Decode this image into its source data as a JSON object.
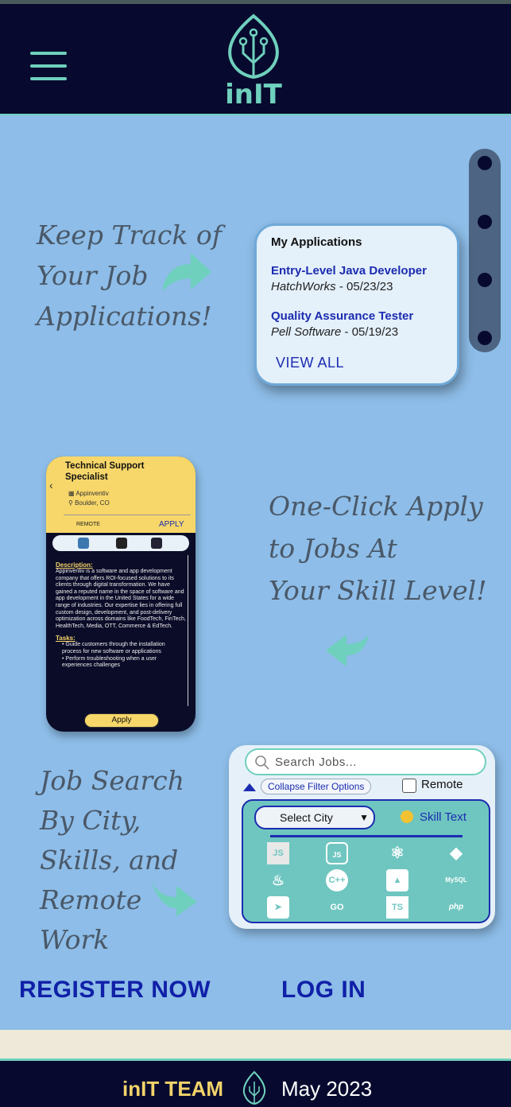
{
  "app": {
    "logo_text": "inIT"
  },
  "hero": {
    "track_lines": [
      "Keep Track of",
      "Your Job",
      "Applications!"
    ],
    "apply_lines": [
      "One-Click Apply",
      "to Jobs At",
      "Your Skill Level!"
    ],
    "search_lines": [
      "Job Search",
      "By City,",
      "Skills, and",
      "Remote",
      "Work"
    ]
  },
  "my_applications": {
    "title": "My Applications",
    "items": [
      {
        "job": "Entry-Level Java Developer",
        "company": "HatchWorks",
        "date": "05/23/23"
      },
      {
        "job": "Quality Assurance Tester",
        "company": "Pell Software",
        "date": "05/19/23"
      }
    ],
    "view_all": "VIEW ALL"
  },
  "job_detail": {
    "title": "Technical Support Specialist",
    "company": "Appinventiv",
    "location": "Boulder, CO",
    "remote": "REMOTE",
    "apply_link": "APPLY",
    "description_label": "Description:",
    "description": "Appinventiv is a software and app development company that offers ROI-focused solutions to its clients through digital transformation. We have gained a reputed name in the space of software and app development in the United States for a wide range of industries. Our expertise lies in offering full custom design, development, and post-delivery optimization across domains like FoodTech, FinTech, HealthTech, Media, OTT, Commerce & EdTech.",
    "tasks_label": "Tasks:",
    "tasks": [
      "Guide customers through the installation process for new software or applications",
      "Perform troubleshooting when a user experiences challenges"
    ],
    "apply_button": "Apply"
  },
  "search_panel": {
    "search_placeholder": "Search Jobs...",
    "collapse_label": "Collapse Filter Options",
    "remote_label": "Remote",
    "select_city": "Select City",
    "skill_text": "Skill Text",
    "skills": [
      "JS",
      "Node.js",
      "React",
      "Python",
      "Java",
      "C++",
      "Power BI",
      "MySQL",
      "Swift",
      "GO",
      "TS",
      "php"
    ]
  },
  "actions": {
    "register": "REGISTER NOW",
    "login": "LOG IN"
  },
  "footer": {
    "team": "inIT TEAM",
    "date": "May 2023"
  },
  "colors": {
    "navy": "#070a2e",
    "teal": "#6fd0bd",
    "sky": "#8dbde8",
    "link": "#1c2cb0",
    "yellow": "#f7d76a"
  }
}
